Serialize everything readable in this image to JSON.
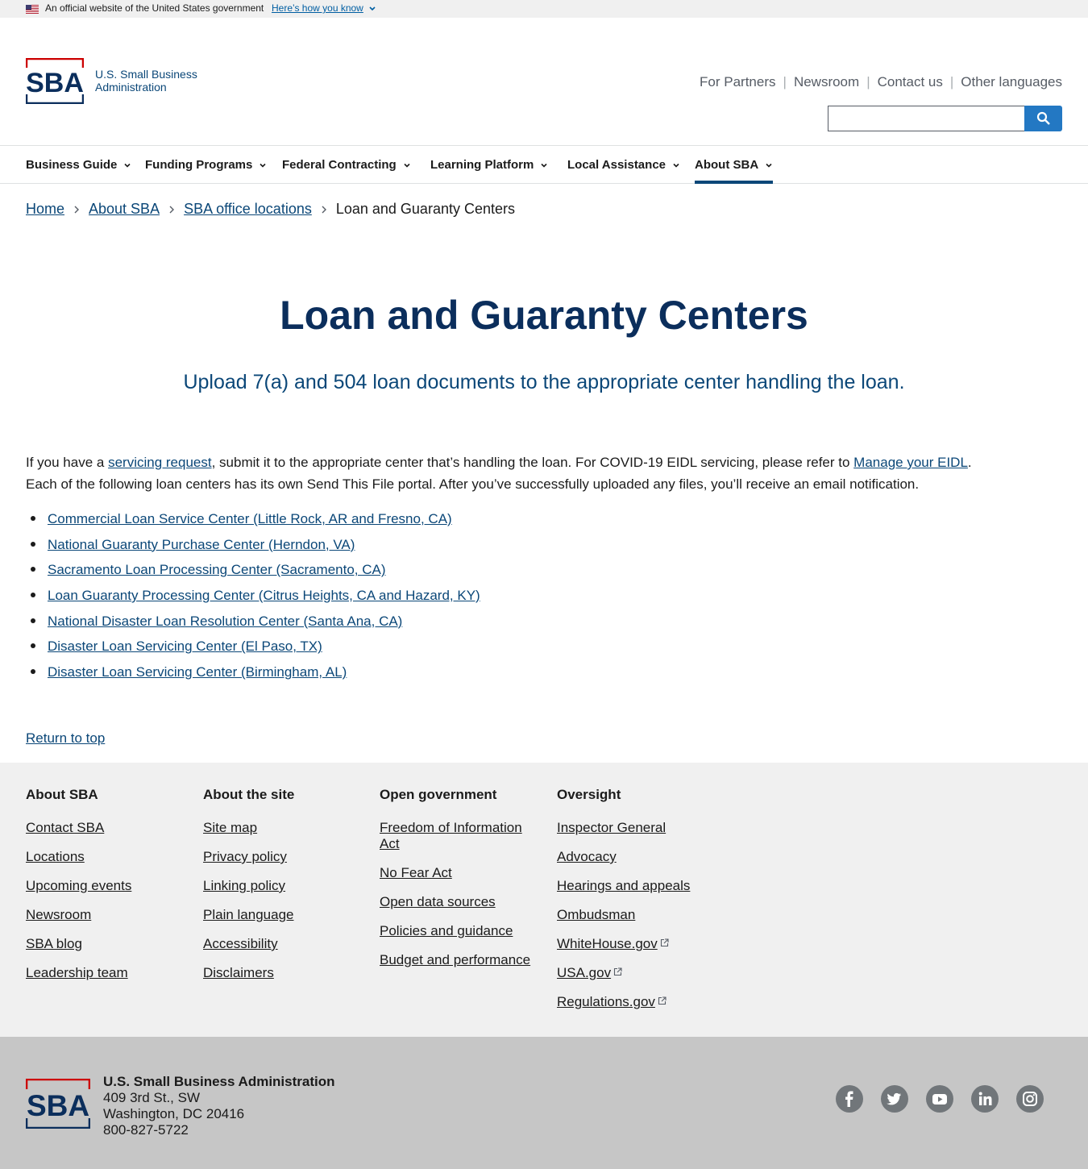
{
  "gov_banner": {
    "text": "An official website of the United States government",
    "link": "Here’s how you know"
  },
  "header": {
    "logo_line1": "U.S. Small Business",
    "logo_line2": "Administration",
    "util_nav": [
      "For Partners",
      "Newsroom",
      "Contact us",
      "Other languages"
    ],
    "search_placeholder": ""
  },
  "main_nav": [
    {
      "label": "Business Guide"
    },
    {
      "label": "Funding Programs"
    },
    {
      "label": "Federal Contracting"
    },
    {
      "label": "Learning Platform"
    },
    {
      "label": "Local Assistance"
    },
    {
      "label": "About SBA",
      "active": true
    }
  ],
  "breadcrumb": {
    "items": [
      "Home",
      "About SBA",
      "SBA office locations"
    ],
    "current": "Loan and Guaranty Centers"
  },
  "hero": {
    "title": "Loan and Guaranty Centers",
    "subtitle": "Upload 7(a) and 504 loan documents to the appropriate center handling the loan."
  },
  "intro": {
    "part1": "If you have a ",
    "link1": "servicing request",
    "part2": ", submit it to the appropriate center that’s handling the loan. For COVID-19 EIDL servicing, please refer to ",
    "link2": "Manage your EIDL",
    "part3": ".",
    "line2": "Each of the following loan centers has its own Send This File portal. After you’ve successfully uploaded any files, you’ll receive an email notification."
  },
  "centers": [
    "Commercial Loan Service Center (Little Rock, AR and Fresno, CA)",
    "National Guaranty Purchase Center (Herndon, VA)",
    "Sacramento Loan Processing Center (Sacramento, CA)",
    "Loan Guaranty Processing Center (Citrus Heights, CA and Hazard, KY)",
    "National Disaster Loan Resolution Center (Santa Ana, CA)",
    "Disaster Loan Servicing Center (El Paso, TX)",
    "Disaster Loan Servicing Center (Birmingham, AL)"
  ],
  "return_to_top": "Return to top",
  "footer": {
    "columns": [
      {
        "heading": "About SBA",
        "links": [
          "Contact SBA",
          "Locations",
          "Upcoming events",
          "Newsroom",
          "SBA blog",
          "Leadership team"
        ]
      },
      {
        "heading": "About the site",
        "links": [
          "Site map",
          "Privacy policy",
          "Linking policy",
          "Plain language",
          "Accessibility",
          "Disclaimers"
        ]
      },
      {
        "heading": "Open government",
        "links": [
          "Freedom of Information Act",
          "No Fear Act",
          "Open data sources",
          "Policies and guidance",
          "Budget and performance"
        ]
      },
      {
        "heading": "Oversight",
        "links": [
          "Inspector General",
          "Advocacy",
          "Hearings and appeals",
          "Ombudsman",
          "WhiteHouse.gov",
          "USA.gov",
          "Regulations.gov"
        ]
      }
    ],
    "org_name": "U.S. Small Business Administration",
    "address1": "409 3rd St., SW",
    "address2": "Washington, DC 20416",
    "phone": "800-827-5722",
    "social": [
      "facebook-icon",
      "twitter-icon",
      "youtube-icon",
      "linkedin-icon",
      "instagram-icon"
    ]
  },
  "colors": {
    "primary_dark": "#0b2e5c",
    "link": "#0b4778",
    "accent_red": "#cc0000",
    "button_blue": "#2378c3"
  }
}
